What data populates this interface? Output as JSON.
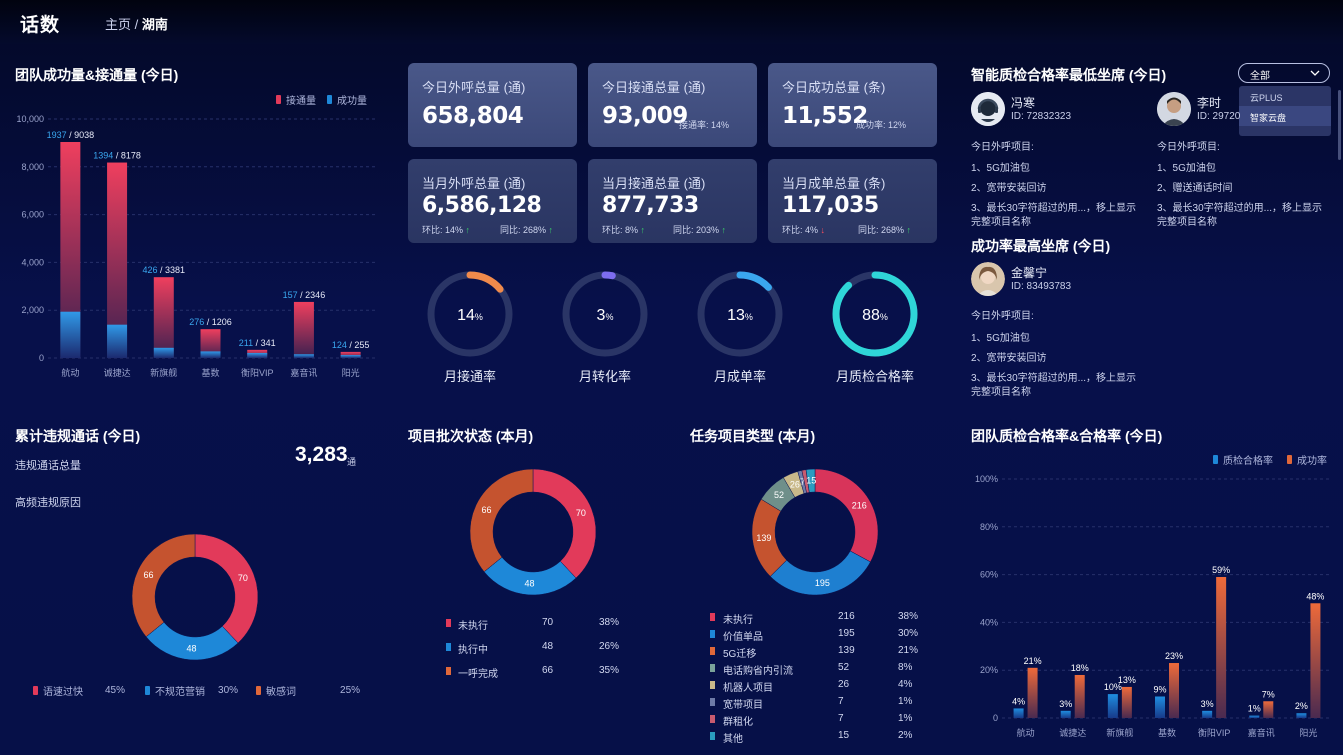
{
  "header": {
    "brand": "话数",
    "breadcrumb_home": "主页",
    "breadcrumb_sep": "/",
    "breadcrumb_current": "湖南"
  },
  "team_volume": {
    "title": "团队成功量&接通量 (今日)",
    "legend": [
      {
        "label": "接通量",
        "color": "#e23a5a"
      },
      {
        "label": "成功量",
        "color": "#1e88d8"
      }
    ]
  },
  "stats": [
    {
      "label": "今日外呼总量 (通)",
      "value": "658,804",
      "sub": ""
    },
    {
      "label": "今日接通总量 (通)",
      "value": "93,009",
      "sub": "接通率: 14%"
    },
    {
      "label": "今日成功总量 (条)",
      "value": "11,552",
      "sub": "成功率: 12%"
    },
    {
      "label": "当月外呼总量 (通)",
      "value": "6,586,128",
      "ring": "环比: 14%",
      "ring_dir": "↑",
      "yoy": "同比: 268%",
      "yoy_dir": "↑"
    },
    {
      "label": "当月接通总量 (通)",
      "value": "877,733",
      "ring": "环比: 8%",
      "ring_dir": "↑",
      "yoy": "同比: 203%",
      "yoy_dir": "↑"
    },
    {
      "label": "当月成单总量 (条)",
      "value": "117,035",
      "ring": "环比: 4%",
      "ring_dir": "↓",
      "yoy": "同比: 268%",
      "yoy_dir": "↑"
    }
  ],
  "gauges": [
    {
      "label": "月接通率",
      "value": 14,
      "text": "14",
      "unit": "%",
      "color": "#f08a4b"
    },
    {
      "label": "月转化率",
      "value": 3,
      "text": "3",
      "unit": "%",
      "color": "#7d6df0"
    },
    {
      "label": "月成单率",
      "value": 13,
      "text": "13",
      "unit": "%",
      "color": "#3aa7ef"
    },
    {
      "label": "月质检合格率",
      "value": 88,
      "text": "88",
      "unit": "%",
      "color": "#2fd6d8"
    }
  ],
  "low_quality": {
    "title": "智能质检合格率最低坐席 (今日)",
    "dropdown": {
      "selected": "全部",
      "options": [
        "云PLUS",
        "智家云盘"
      ]
    },
    "agents": [
      {
        "name": "冯寒",
        "id": "ID: 72832323",
        "project_title": "今日外呼项目:",
        "items": [
          "1、5G加油包",
          "2、宽带安装回访",
          "3、最长30字符超过的用...，移上显示",
          "完整项目名称"
        ]
      },
      {
        "name": "李时",
        "id": "ID: 29720",
        "project_title": "今日外呼项目:",
        "items": [
          "1、5G加油包",
          "2、赠送通话时间",
          "3、最长30字符超过的用...，移上显示",
          "完整项目名称"
        ]
      }
    ]
  },
  "top_success": {
    "title": "成功率最高坐席 (今日)",
    "agent": {
      "name": "金馨宁",
      "id": "ID: 83493783",
      "project_title": "今日外呼项目:",
      "items": [
        "1、5G加油包",
        "2、宽带安装回访",
        "3、最长30字符超过的用...，移上显示",
        "完整项目名称"
      ]
    }
  },
  "violations": {
    "title": "累计违规通话 (今日)",
    "total_label": "违规通话总量",
    "total_value": "3,283",
    "total_unit": "通",
    "reasons_title": "高频违规原因",
    "legend": [
      {
        "label": "语速过快",
        "pct": "45%",
        "color": "#e23a5a"
      },
      {
        "label": "不规范营销",
        "pct": "30%",
        "color": "#1e88d8"
      },
      {
        "label": "敏感词",
        "pct": "25%",
        "color": "#e0683a"
      }
    ]
  },
  "batch_status": {
    "title": "项目批次状态 (本月)",
    "rows": [
      {
        "label": "未执行",
        "count": "70",
        "pct": "38%",
        "color": "#e23a5a"
      },
      {
        "label": "执行中",
        "count": "48",
        "pct": "26%",
        "color": "#1e88d8"
      },
      {
        "label": "一呼完成",
        "count": "66",
        "pct": "35%",
        "color": "#e0683a"
      }
    ]
  },
  "task_types": {
    "title": "任务项目类型 (本月)",
    "rows": [
      {
        "label": "未执行",
        "count": "216",
        "pct": "38%",
        "color": "#e23a5a"
      },
      {
        "label": "价值单品",
        "count": "195",
        "pct": "30%",
        "color": "#1e88d8"
      },
      {
        "label": "5G迁移",
        "count": "139",
        "pct": "21%",
        "color": "#e0683a"
      },
      {
        "label": "电话购省内引流",
        "count": "52",
        "pct": "8%",
        "color": "#7aa39a"
      },
      {
        "label": "机器人项目",
        "count": "26",
        "pct": "4%",
        "color": "#c9b98a"
      },
      {
        "label": "宽带项目",
        "count": "7",
        "pct": "1%",
        "color": "#6e7ba8"
      },
      {
        "label": "群租化",
        "count": "7",
        "pct": "1%",
        "color": "#c85b6f"
      },
      {
        "label": "其他",
        "count": "15",
        "pct": "2%",
        "color": "#2a9cc0"
      }
    ]
  },
  "team_quality": {
    "title": "团队质检合格率&合格率 (今日)",
    "legend": [
      {
        "label": "质检合格率",
        "color": "#1e88d8"
      },
      {
        "label": "成功率",
        "color": "#e0683a"
      }
    ]
  },
  "chart_data": [
    {
      "type": "bar",
      "title": "团队成功量&接通量 (今日)",
      "categories": [
        "航动",
        "诚捷达",
        "新旗舰",
        "基数",
        "衡阳VIP",
        "嘉音讯",
        "阳光"
      ],
      "series": [
        {
          "name": "接通量",
          "values": [
            9038,
            8178,
            3381,
            1206,
            341,
            2346,
            255
          ]
        },
        {
          "name": "成功量",
          "values": [
            1937,
            1394,
            426,
            276,
            211,
            157,
            124
          ]
        }
      ],
      "ylim": [
        0,
        10000
      ],
      "yticks": [
        "0",
        "2,000",
        "4,000",
        "6,000",
        "8,000",
        "10,000"
      ],
      "labels_success": [
        "1937",
        "1394",
        "426",
        "276",
        "211",
        "157",
        "124"
      ],
      "labels_total": [
        "9038",
        "8178",
        "3381",
        "1206",
        "341",
        "2346",
        "255"
      ]
    },
    {
      "type": "pie",
      "title": "高频违规原因",
      "categories": [
        "语速过快",
        "不规范营销",
        "敏感词"
      ],
      "values": [
        70,
        48,
        66
      ],
      "value_labels": [
        "70",
        "48",
        "66"
      ]
    },
    {
      "type": "pie",
      "title": "项目批次状态 (本月)",
      "categories": [
        "未执行",
        "执行中",
        "一呼完成"
      ],
      "values": [
        70,
        48,
        66
      ],
      "value_labels": [
        "70",
        "48",
        "66"
      ]
    },
    {
      "type": "pie",
      "title": "任务项目类型 (本月)",
      "categories": [
        "未执行",
        "价值单品",
        "5G迁移",
        "电话购省内引流",
        "机器人项目",
        "宽带项目",
        "群租化",
        "其他"
      ],
      "values": [
        216,
        195,
        139,
        52,
        26,
        7,
        7,
        15
      ],
      "value_labels": [
        "216",
        "195",
        "139",
        "52",
        "26",
        "7",
        "",
        "15"
      ]
    },
    {
      "type": "bar",
      "title": "团队质检合格率&合格率 (今日)",
      "categories": [
        "航动",
        "诚捷达",
        "新旗舰",
        "基数",
        "衡阳VIP",
        "嘉音讯",
        "阳光"
      ],
      "series": [
        {
          "name": "质检合格率",
          "values": [
            4,
            3,
            10,
            9,
            3,
            1,
            2
          ]
        },
        {
          "name": "成功率",
          "values": [
            21,
            18,
            13,
            23,
            59,
            7,
            48
          ]
        }
      ],
      "ylim": [
        0,
        100
      ],
      "yticks": [
        "0",
        "20%",
        "40%",
        "60%",
        "80%",
        "100%"
      ],
      "labels_a": [
        "4%",
        "3%",
        "10%",
        "9%",
        "3%",
        "1%",
        "2%"
      ],
      "labels_b": [
        "21%",
        "18%",
        "13%",
        "23%",
        "59%",
        "7%",
        "48%"
      ]
    }
  ]
}
